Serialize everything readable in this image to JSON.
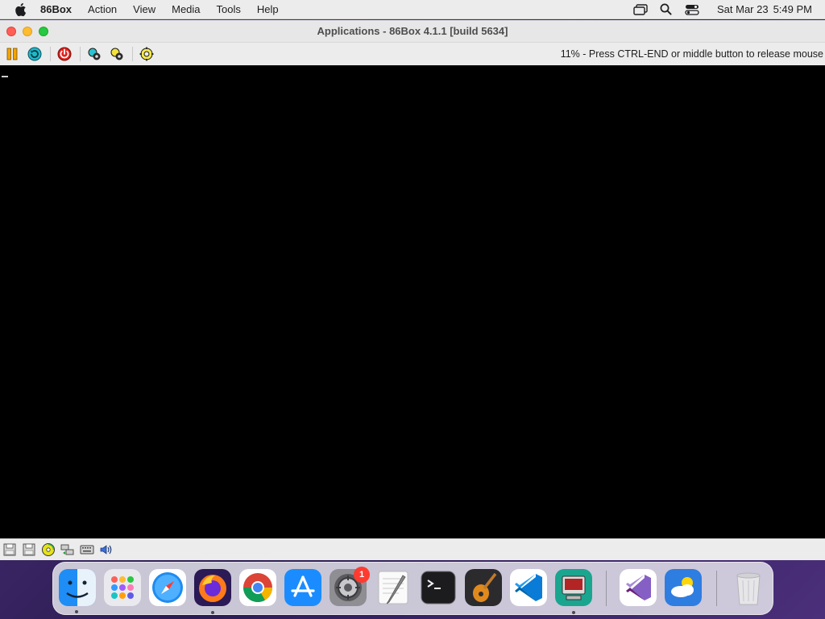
{
  "menubar": {
    "app_name": "86Box",
    "items": [
      "Action",
      "View",
      "Media",
      "Tools",
      "Help"
    ],
    "clock": {
      "date": "Sat Mar 23",
      "time": "5:49 PM"
    }
  },
  "window": {
    "title": "Applications - 86Box 4.1.1 [build 5634]",
    "status_message": "11% - Press CTRL-END or middle button to release mouse",
    "toolbar_icons": [
      "pause-icon",
      "reset-icon",
      "power-icon",
      "settings-icon",
      "settings-alt-icon",
      "gear-icon"
    ],
    "statusbar_icons": [
      "floppy-drive-1-icon",
      "floppy-drive-2-icon",
      "cdrom-icon",
      "network-icon",
      "keyboard-icon",
      "sound-icon"
    ]
  },
  "dock": {
    "apps": [
      "Finder",
      "Launchpad",
      "Safari",
      "Firefox",
      "Chrome",
      "App Store",
      "System Settings",
      "TextEdit",
      "Terminal",
      "GarageBand",
      "Visual Studio Code",
      "86Box",
      "Visual Studio",
      "Weather",
      "Trash"
    ],
    "settings_badge": "1"
  },
  "colors": {
    "menubar_bg": "#ececec",
    "window_bg": "#ececec",
    "screen_bg": "#000000",
    "close": "#ff5f57",
    "minimize": "#febc2e",
    "maximize": "#28c840",
    "badge": "#ff3b30"
  }
}
